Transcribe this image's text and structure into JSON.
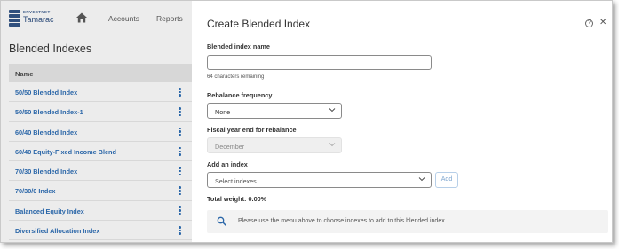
{
  "app": {
    "logo_top": "ENVESTNET",
    "logo_main": "Tamarac",
    "nav": {
      "accounts": "Accounts",
      "reports": "Reports"
    }
  },
  "list_page": {
    "title": "Blended Indexes",
    "column_name": "Name",
    "rows": [
      "50/50 Blended Index",
      "50/50 Blended Index-1",
      "60/40 Blended Index",
      "60/40 Equity-Fixed Income Blend",
      "70/30 Blended Index",
      "70/30/0 Index",
      "Balanced Equity Index",
      "Diversified Allocation Index"
    ]
  },
  "dialog": {
    "title": "Create Blended Index",
    "name_label": "Blended index name",
    "name_value": "",
    "chars_remaining": "64 characters remaining",
    "rebalance_label": "Rebalance frequency",
    "rebalance_value": "None",
    "fiscal_label": "Fiscal year end for rebalance",
    "fiscal_value": "December",
    "add_index_label": "Add an index",
    "index_placeholder": "Select indexes",
    "add_button": "Add",
    "total_weight": "Total weight: 0.00%",
    "info_message": "Please use the menu above to choose indexes to add to this blended index."
  },
  "colors": {
    "link_blue": "#2a66a8",
    "brand_navy": "#2b4a78",
    "dim_gray": "#ececec"
  },
  "icons": [
    "home-icon",
    "kebab-icon",
    "help-icon",
    "close-icon",
    "chevron-down-icon",
    "search-icon"
  ]
}
